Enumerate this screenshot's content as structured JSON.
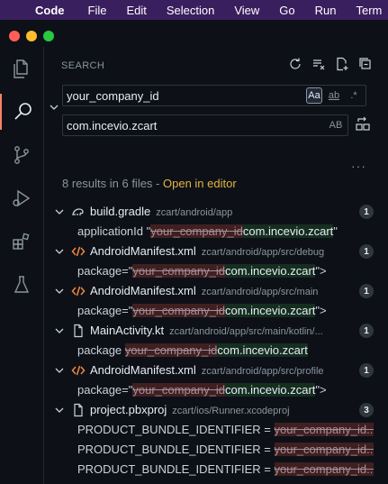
{
  "menubar": {
    "items": [
      "Code",
      "File",
      "Edit",
      "Selection",
      "View",
      "Go",
      "Run",
      "Term"
    ]
  },
  "search": {
    "title": "SEARCH",
    "query": "your_company_id",
    "replace": "com.incevio.zcart",
    "options": {
      "match_case": "Aa",
      "whole_word": "ab",
      "regex": ".*",
      "preserve_case": "AB"
    },
    "summary_text": "8 results in 6 files - ",
    "open_in_editor": "Open in editor"
  },
  "files": [
    {
      "name": "build.gradle",
      "path": "zcart/android/app",
      "count": "1",
      "icon": "gradle-icon",
      "matches": [
        {
          "prefix": "applicationId \"",
          "old": "your_company_id",
          "new": "com.incevio.zcart",
          "suffix": "\""
        }
      ]
    },
    {
      "name": "AndroidManifest.xml",
      "path": "zcart/android/app/src/debug",
      "count": "1",
      "icon": "xml-icon",
      "matches": [
        {
          "prefix": "package=\"",
          "old": "your_company_id",
          "new": "com.incevio.zcart",
          "suffix": "\">"
        }
      ]
    },
    {
      "name": "AndroidManifest.xml",
      "path": "zcart/android/app/src/main",
      "count": "1",
      "icon": "xml-icon",
      "matches": [
        {
          "prefix": "package=\"",
          "old": "your_company_id",
          "new": "com.incevio.zcart",
          "suffix": "\">"
        }
      ]
    },
    {
      "name": "MainActivity.kt",
      "path": "zcart/android/app/src/main/kotlin/...",
      "count": "1",
      "icon": "file-icon",
      "matches": [
        {
          "prefix": "package ",
          "old": "your_company_id",
          "new": "com.incevio.zcart",
          "suffix": ""
        }
      ]
    },
    {
      "name": "AndroidManifest.xml",
      "path": "zcart/android/app/src/profile",
      "count": "1",
      "icon": "xml-icon",
      "matches": [
        {
          "prefix": "package=\"",
          "old": "your_company_id",
          "new": "com.incevio.zcart",
          "suffix": "\">"
        }
      ]
    },
    {
      "name": "project.pbxproj",
      "path": "zcart/ios/Runner.xcodeproj",
      "count": "3",
      "icon": "file-icon",
      "matches": [
        {
          "prefix": "PRODUCT_BUNDLE_IDENTIFIER = ",
          "old": "your_company_id...",
          "new": "",
          "suffix": ""
        },
        {
          "prefix": "PRODUCT_BUNDLE_IDENTIFIER = ",
          "old": "your_company_id...",
          "new": "",
          "suffix": ""
        },
        {
          "prefix": "PRODUCT_BUNDLE_IDENTIFIER = ",
          "old": "your_company_id...",
          "new": "",
          "suffix": ""
        }
      ]
    }
  ],
  "colors": {
    "accent": "#e3b341",
    "menubar": "#3a1f5e",
    "xml_icon": "#f0883e",
    "delete": "#f85149",
    "insert": "#3fb950"
  }
}
